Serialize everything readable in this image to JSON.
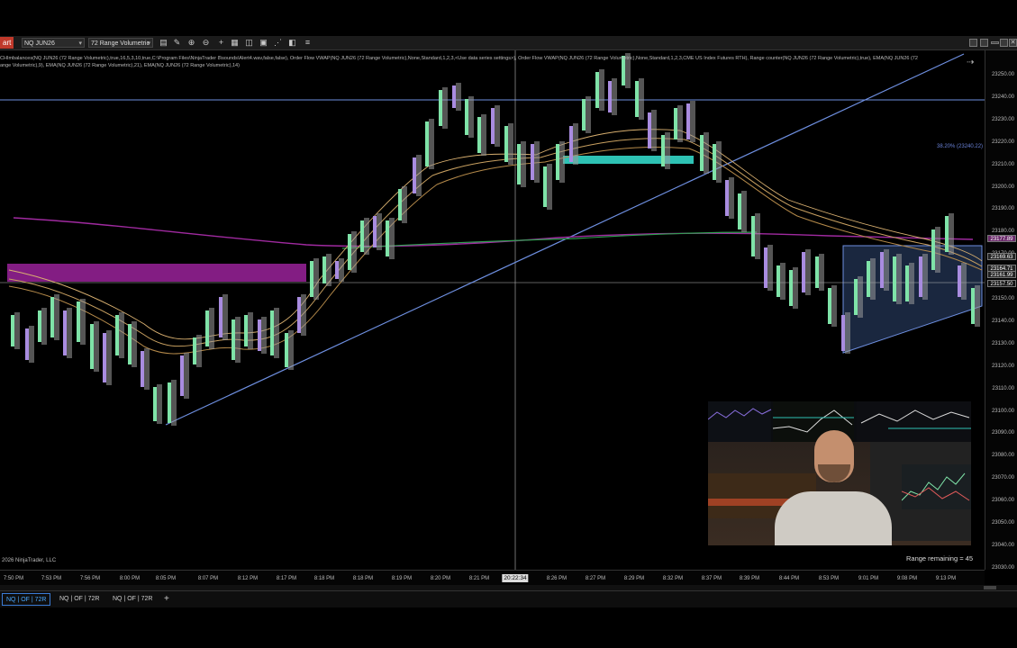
{
  "toolbar": {
    "chart_badge": "art",
    "instrument": "NQ JUN26",
    "bar_type": "72 Range Volumetric"
  },
  "indicators_text": "CHImbalances(NQ JUN26 (72 Range Volumetric),true,16,5,3,10,true,C:\\Program Files\\NinjaTrader 8\\sounds\\Alert4.wav,false,false), Order Flow VWAP(NQ JUN26 (72 Range Volumetric),None,Standard,1,2,3,<Use data series settings>), Order Flow VWAP(NQ JUN26 (72 Range Volumetric),None,Standard,1,2,3,CME US Index Futures RTH), Range counter(NQ JUN26 (72 Range Volumetric),true), EMA(NQ JUN26 (72",
  "indicators_text_2": "ange Volumetric),9), EMA(NQ JUN26 (72 Range Volumetric),21), EMA(NQ JUN26 (72 Range Volumetric),14)",
  "fib_label": "38.20% (23240.22)",
  "price_axis": {
    "ticks": [
      "23250.00",
      "23240.00",
      "23230.00",
      "23220.00",
      "23210.00",
      "23200.00",
      "23190.00",
      "23180.00",
      "23170.00",
      "23160.00",
      "23150.00",
      "23140.00",
      "23130.00",
      "23120.00",
      "23110.00",
      "23100.00",
      "23090.00",
      "23080.00",
      "23070.00",
      "23060.00",
      "23050.00",
      "23040.00",
      "23030.00"
    ],
    "tags": [
      {
        "text": "23177.89",
        "bg": "#6b2a6b"
      },
      {
        "text": "23169.63",
        "bg": "#222222"
      },
      {
        "text": "23164.71",
        "bg": "#222222"
      },
      {
        "text": "23161.99",
        "bg": "#222222"
      },
      {
        "text": "23157.50",
        "bg": "#111111"
      }
    ]
  },
  "time_axis": {
    "labels": [
      "7:50 PM",
      "7:53 PM",
      "7:56 PM",
      "8:00 PM",
      "8:05 PM",
      "8:07 PM",
      "8:12 PM",
      "8:17 PM",
      "8:18 PM",
      "8:18 PM",
      "8:19 PM",
      "8:20 PM",
      "8:21 PM",
      "8:26 PM",
      "8:27 PM",
      "8:29 PM",
      "8:32 PM",
      "8:37 PM",
      "8:39 PM",
      "8:44 PM",
      "8:53 PM",
      "9:01 PM",
      "9:08 PM",
      "9:13 PM"
    ],
    "cursor": "20:22:34"
  },
  "copyright": "2026 NinjaTrader, LLC",
  "range_remaining": "Range remaining = 45",
  "tabs": [
    "NQ | OF | 72R",
    "NQ | OF | 72R",
    "NQ | OF | 72R"
  ],
  "add_tab": "+",
  "colors": {
    "bull": "#7fe3a8",
    "bear": "#a98ce0",
    "trendline": "#6e8fe0",
    "vwap_magenta": "#8a1f8a",
    "vwap_green": "#2fa050",
    "ema": "#c8a060",
    "highlight_cyan": "#2ec2b4"
  }
}
